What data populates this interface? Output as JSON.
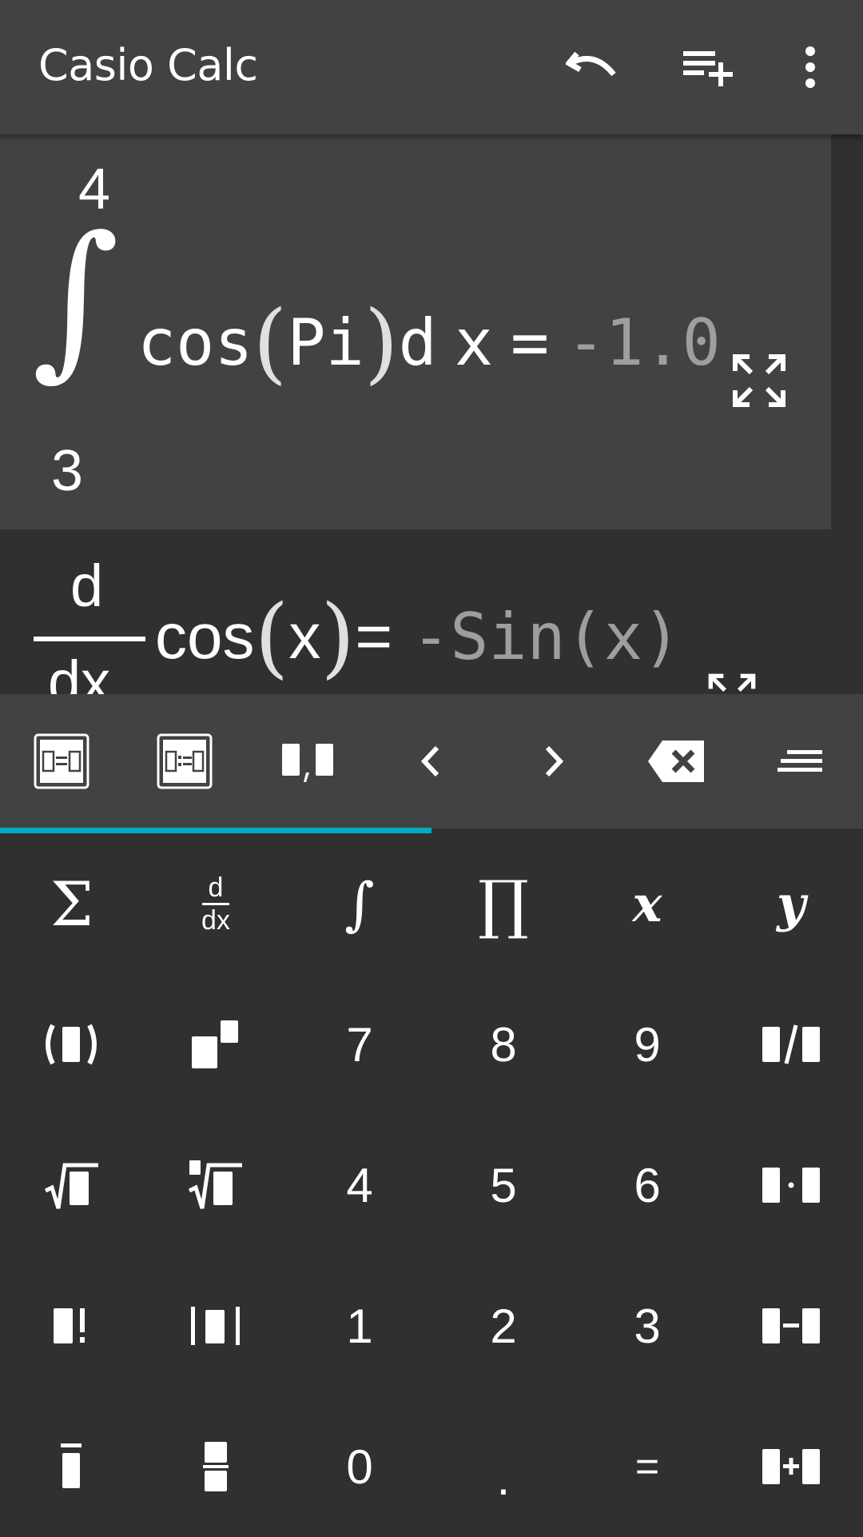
{
  "app": {
    "title": "Casio Calc",
    "actions": [
      {
        "name": "undo",
        "icon": "undo-icon"
      },
      {
        "name": "add-line",
        "icon": "playlist-add-icon"
      },
      {
        "name": "overflow-menu",
        "icon": "more-vert-icon"
      }
    ]
  },
  "history": {
    "entry1": {
      "upper_limit": "4",
      "lower_limit": "3",
      "integrand": "cos",
      "argument": "Pi",
      "differential_d": "d",
      "differential_var": "x",
      "equals": "=",
      "result": "-1.0",
      "expand_icon": "expand-icon"
    },
    "entry2": {
      "numerator": "d",
      "denominator": "dx",
      "function": "cos",
      "argument": "x",
      "equals": "=",
      "result": "-Sin(x)",
      "expand_icon": "expand-icon"
    }
  },
  "toolbar": {
    "buttons": [
      "solve-equation-icon",
      "define-equation-icon",
      "comma-separator-icon",
      "cursor-left-icon",
      "cursor-right-icon",
      "backspace-icon",
      "menu-lines-icon"
    ]
  },
  "keypad": {
    "rows": [
      [
        "Σ",
        "d/dx",
        "∫",
        "∏",
        "x",
        "y"
      ],
      [
        "(□)",
        "□²",
        "7",
        "8",
        "9",
        "□/□"
      ],
      [
        "√□",
        "ⁿ√□",
        "4",
        "5",
        "6",
        "□·□"
      ],
      [
        "□!",
        "|□|",
        "1",
        "2",
        "3",
        "□−□"
      ],
      [
        "□̄",
        "□/□frac",
        "0",
        ".",
        "=",
        "□+□"
      ]
    ],
    "text_keys": {
      "sum": "Σ",
      "derivative_top": "d",
      "derivative_bottom": "dx",
      "integral": "∫",
      "product": "∏",
      "x": "x",
      "y": "y",
      "seven": "7",
      "eight": "8",
      "nine": "9",
      "four": "4",
      "five": "5",
      "six": "6",
      "one": "1",
      "two": "2",
      "three": "3",
      "zero": "0",
      "dot": ".",
      "equals": "=",
      "minus": "−",
      "plus": "+",
      "factorial": "!"
    }
  },
  "colors": {
    "appbar": "#424242",
    "background": "#303030",
    "accent": "#00acc1",
    "result_text": "#9e9e9e"
  }
}
